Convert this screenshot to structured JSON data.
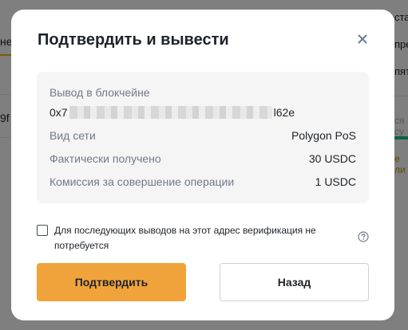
{
  "background": {
    "left_tab_fragment": "не",
    "left_row_fragment": "9f",
    "right_fragments": [
      "ста",
      "пре",
      "пят"
    ],
    "right_grey_fragment": "ся су",
    "right_orange_fragment": "е ли"
  },
  "modal": {
    "title": "Подтвердить и вывести",
    "close_icon": "close-icon",
    "details": {
      "address_label": "Вывод в блокчейне",
      "address_prefix": "0x7",
      "address_suffix": "l62e",
      "network_label": "Вид сети",
      "network_value": "Polygon PoS",
      "received_label": "Фактически получено",
      "received_value": "30 USDC",
      "fee_label": "Комиссия за совершение операции",
      "fee_value": "1 USDC"
    },
    "checkbox": {
      "checked": false,
      "label": "Для последующих выводов на этот адрес верификация не потребуется"
    },
    "help_icon": "question-circle-icon",
    "confirm_label": "Подтвердить",
    "back_label": "Назад"
  },
  "colors": {
    "primary_button": "#f0a33a",
    "text_primary": "#1e2329",
    "text_secondary": "#707a8a",
    "info_box_bg": "#f5f5f5"
  }
}
